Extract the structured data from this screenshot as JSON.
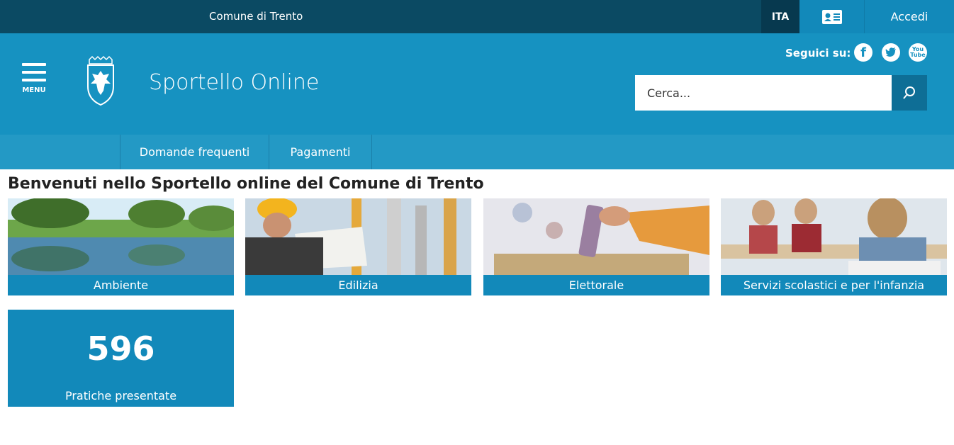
{
  "topbar": {
    "org_name": "Comune di Trento",
    "lang": "ITA",
    "login_label": "Accedi"
  },
  "header": {
    "menu_label": "MENU",
    "site_title": "Sportello Online",
    "follow_label": "Seguici su:",
    "search_placeholder": "Cerca...",
    "social": [
      "facebook",
      "twitter",
      "youtube"
    ]
  },
  "nav": {
    "items": [
      "Domande frequenti",
      "Pagamenti"
    ]
  },
  "main": {
    "heading": "Benvenuti nello Sportello online del Comune di Trento",
    "tiles": [
      {
        "label": "Ambiente"
      },
      {
        "label": "Edilizia"
      },
      {
        "label": "Elettorale"
      },
      {
        "label": "Servizi scolastici e per l'infanzia"
      }
    ],
    "stat": {
      "value": "596",
      "label": "Pratiche presentate"
    }
  },
  "colors": {
    "topbar": "#0b4a63",
    "header": "#1692c1",
    "nav": "#2399c5",
    "accent": "#1289ba"
  }
}
